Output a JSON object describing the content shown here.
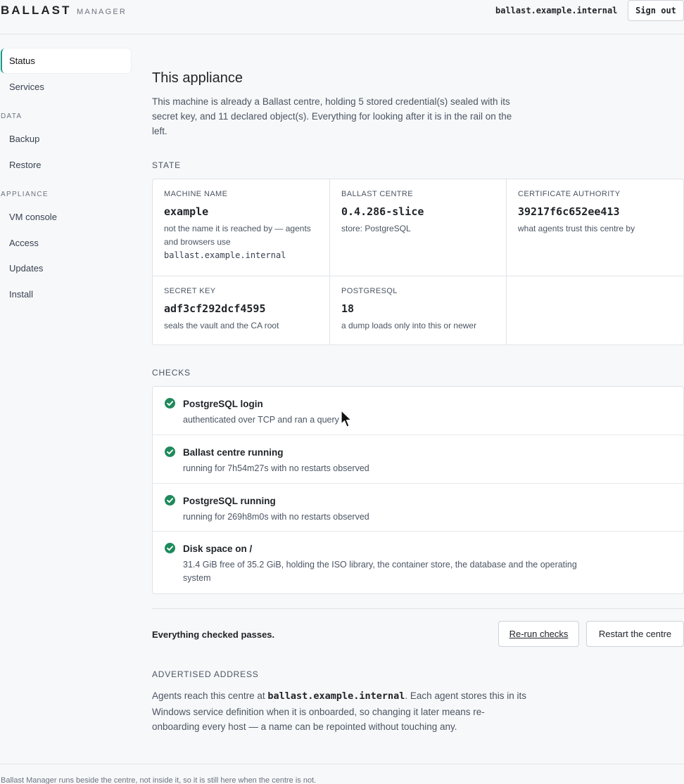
{
  "header": {
    "logo": "BALLAST",
    "logo_sub": "MANAGER",
    "host": "ballast.example.internal",
    "sign_out": "Sign out"
  },
  "sidebar": {
    "items_top": [
      {
        "label": "Status",
        "active": true
      },
      {
        "label": "Services"
      }
    ],
    "section_data": "DATA",
    "items_data": [
      {
        "label": "Backup"
      },
      {
        "label": "Restore"
      }
    ],
    "section_appliance": "APPLIANCE",
    "items_appliance": [
      {
        "label": "VM console"
      },
      {
        "label": "Access"
      },
      {
        "label": "Updates"
      },
      {
        "label": "Install"
      }
    ]
  },
  "main": {
    "title": "This appliance",
    "intro": "This machine is already a Ballast centre, holding 5 stored credential(s) sealed with its secret key, and 11 declared object(s). Everything for looking after it is in the rail on the left.",
    "state_label": "STATE",
    "state": {
      "machine_name": {
        "label": "MACHINE NAME",
        "value": "example",
        "note_pre": "not the name it is reached by — agents and browsers use",
        "note_code": "ballast.example.internal"
      },
      "ballast_centre": {
        "label": "BALLAST CENTRE",
        "value": "0.4.286-slice",
        "note": "store: PostgreSQL"
      },
      "certificate_authority": {
        "label": "CERTIFICATE AUTHORITY",
        "value": "39217f6c652ee413",
        "note": "what agents trust this centre by"
      },
      "secret_key": {
        "label": "SECRET KEY",
        "value": "adf3cf292dcf4595",
        "note": "seals the vault and the CA root"
      },
      "postgresql": {
        "label": "POSTGRESQL",
        "value": "18",
        "note": "a dump loads only into this or newer"
      }
    },
    "checks_label": "CHECKS",
    "checks": [
      {
        "title": "PostgreSQL login",
        "detail": "authenticated over TCP and ran a query",
        "status": "pass"
      },
      {
        "title": "Ballast centre running",
        "detail": "running for 7h54m27s with no restarts observed",
        "status": "pass"
      },
      {
        "title": "PostgreSQL running",
        "detail": "running for 269h8m0s with no restarts observed",
        "status": "pass"
      },
      {
        "title": "Disk space on /",
        "detail": "31.4 GiB free of 35.2 GiB, holding the ISO library, the container store, the database and the operating system",
        "status": "pass"
      }
    ],
    "summary": "Everything checked passes.",
    "rerun_button": "Re-run checks",
    "restart_button": "Restart the centre",
    "address_label": "ADVERTISED ADDRESS",
    "address_pre": "Agents reach this centre at ",
    "address_code": "ballast.example.internal",
    "address_post": ". Each agent stores this in its Windows service definition when it is onboarded, so changing it later means re-onboarding every host — a name can be repointed without touching any."
  },
  "footer": {
    "text": "Ballast Manager runs beside the centre, not inside it, so it is still here when the centre is not."
  },
  "colors": {
    "accent": "#1a9a8a",
    "pass_green": "#1f8a5b"
  }
}
